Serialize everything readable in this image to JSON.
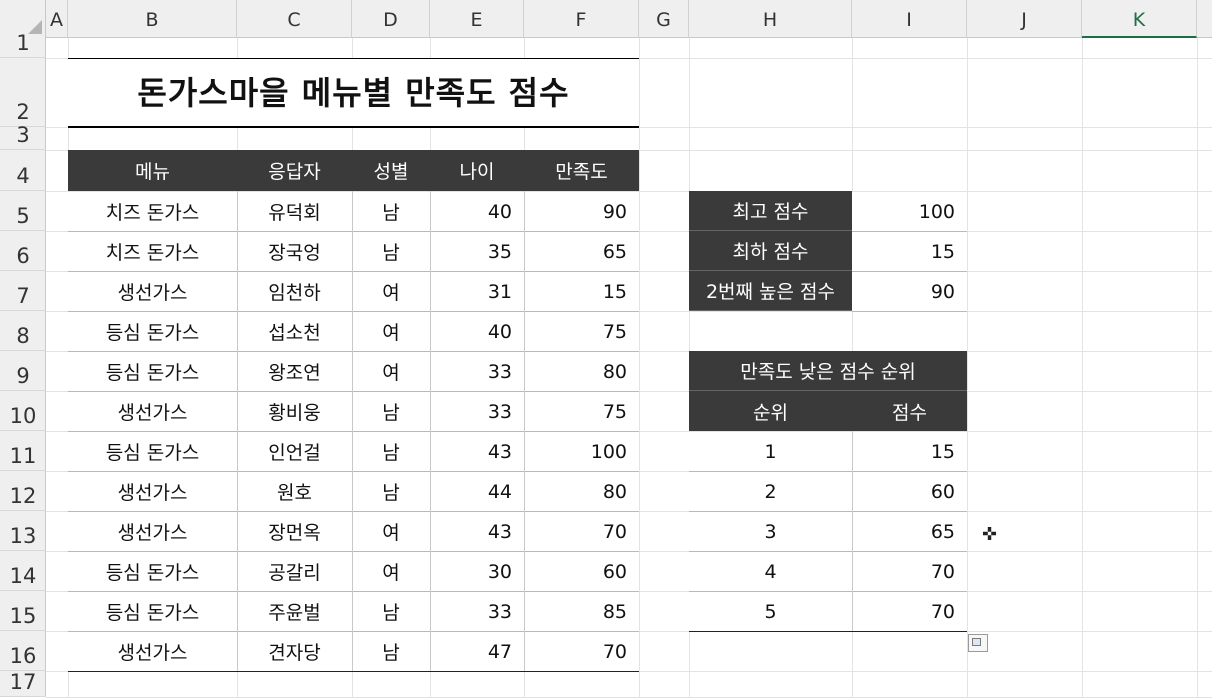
{
  "columns": [
    "A",
    "B",
    "C",
    "D",
    "E",
    "F",
    "G",
    "H",
    "I",
    "J",
    "K"
  ],
  "rows": [
    "1",
    "2",
    "3",
    "4",
    "5",
    "6",
    "7",
    "8",
    "9",
    "10",
    "11",
    "12",
    "13",
    "14",
    "15",
    "16",
    "17"
  ],
  "title": "돈가스마을 메뉴별 만족도 점수",
  "table": {
    "headers": [
      "메뉴",
      "응답자",
      "성별",
      "나이",
      "만족도"
    ],
    "rows": [
      [
        "치즈 돈가스",
        "유덕회",
        "남",
        "40",
        "90"
      ],
      [
        "치즈 돈가스",
        "장국엉",
        "남",
        "35",
        "65"
      ],
      [
        "생선가스",
        "임천하",
        "여",
        "31",
        "15"
      ],
      [
        "등심 돈가스",
        "섭소천",
        "여",
        "40",
        "75"
      ],
      [
        "등심 돈가스",
        "왕조연",
        "여",
        "33",
        "80"
      ],
      [
        "생선가스",
        "황비웅",
        "남",
        "33",
        "75"
      ],
      [
        "등심 돈가스",
        "인언걸",
        "남",
        "43",
        "100"
      ],
      [
        "생선가스",
        "원호",
        "남",
        "44",
        "80"
      ],
      [
        "생선가스",
        "장먼옥",
        "여",
        "43",
        "70"
      ],
      [
        "등심 돈가스",
        "공갈리",
        "여",
        "30",
        "60"
      ],
      [
        "등심 돈가스",
        "주윤벌",
        "남",
        "33",
        "85"
      ],
      [
        "생선가스",
        "견자당",
        "남",
        "47",
        "70"
      ]
    ]
  },
  "stats": [
    {
      "label": "최고 점수",
      "value": "100"
    },
    {
      "label": "최하 점수",
      "value": "15"
    },
    {
      "label": "2번째 높은 점수",
      "value": "90"
    }
  ],
  "rank": {
    "title": "만족도 낮은 점수 순위",
    "headers": [
      "순위",
      "점수"
    ],
    "rows": [
      [
        "1",
        "15"
      ],
      [
        "2",
        "60"
      ],
      [
        "3",
        "65"
      ],
      [
        "4",
        "70"
      ],
      [
        "5",
        "70"
      ]
    ]
  },
  "selected_column": "K"
}
